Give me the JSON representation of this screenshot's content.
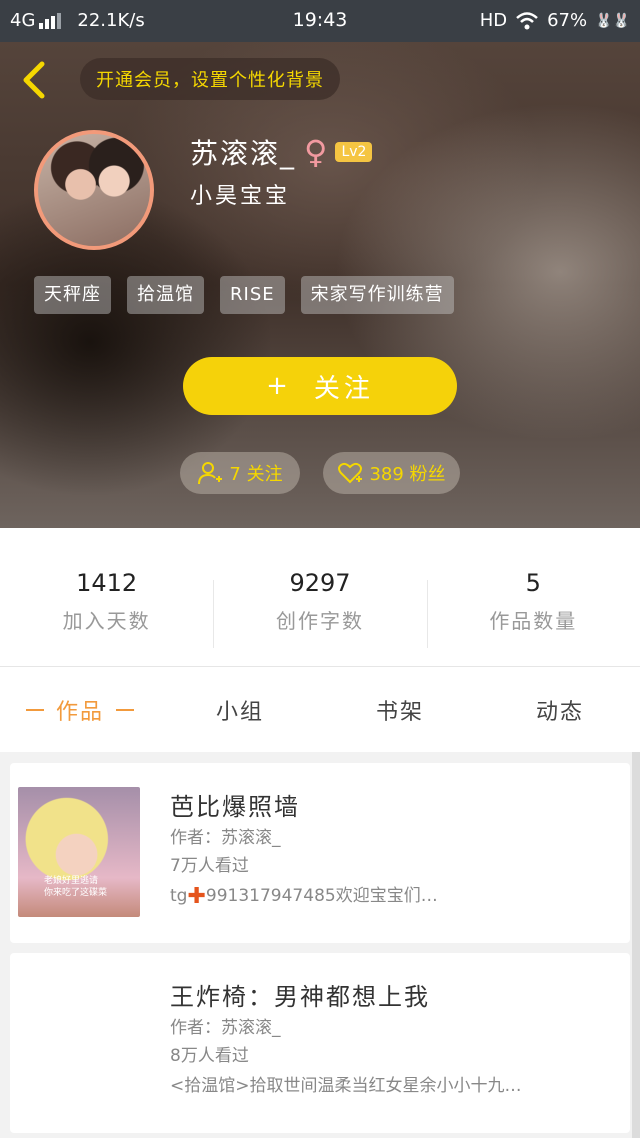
{
  "status_bar": {
    "network": "4G",
    "speed": "22.1K/s",
    "time": "19:43",
    "hd": "HD",
    "battery": "67%",
    "status_icons": "🐰🐰"
  },
  "header": {
    "back_icon": "chevron-left-icon",
    "vip_banner": "开通会员，设置个性化背景"
  },
  "profile": {
    "name": "苏滚滚_",
    "gender_symbol": "♀",
    "level": "Lv2",
    "subtitle": "小昊宝宝",
    "tags": [
      "天秤座",
      "拾温馆",
      "RISE",
      "宋家写作训练营"
    ],
    "follow_plus": "+",
    "follow_label": "关注",
    "following_label": "7 关注",
    "fans_label": "389 粉丝"
  },
  "stats": [
    {
      "value": "1412",
      "label": "加入天数"
    },
    {
      "value": "9297",
      "label": "创作字数"
    },
    {
      "value": "5",
      "label": "作品数量"
    }
  ],
  "tabs": [
    "作品",
    "小组",
    "书架",
    "动态"
  ],
  "works": [
    {
      "title": "芭比爆照墙",
      "author": "作者：苏滚滚_",
      "views": "7万人看过",
      "desc_prefix": "tg",
      "desc_symbol": "✚",
      "desc_rest": "991317947485欢迎宝宝们…",
      "cover_caption": "老娘好里逃请\n你来吃了这碟菜"
    },
    {
      "title": "王炸椅：男神都想上我",
      "author": "作者：苏滚滚_",
      "views": "8万人看过",
      "desc": "<拾温馆>拾取世间温柔当红女星余小小十九…"
    }
  ],
  "colors": {
    "accent_yellow": "#f5d20a",
    "tab_active": "#f29a3c",
    "avatar_border": "#f29a7a"
  }
}
